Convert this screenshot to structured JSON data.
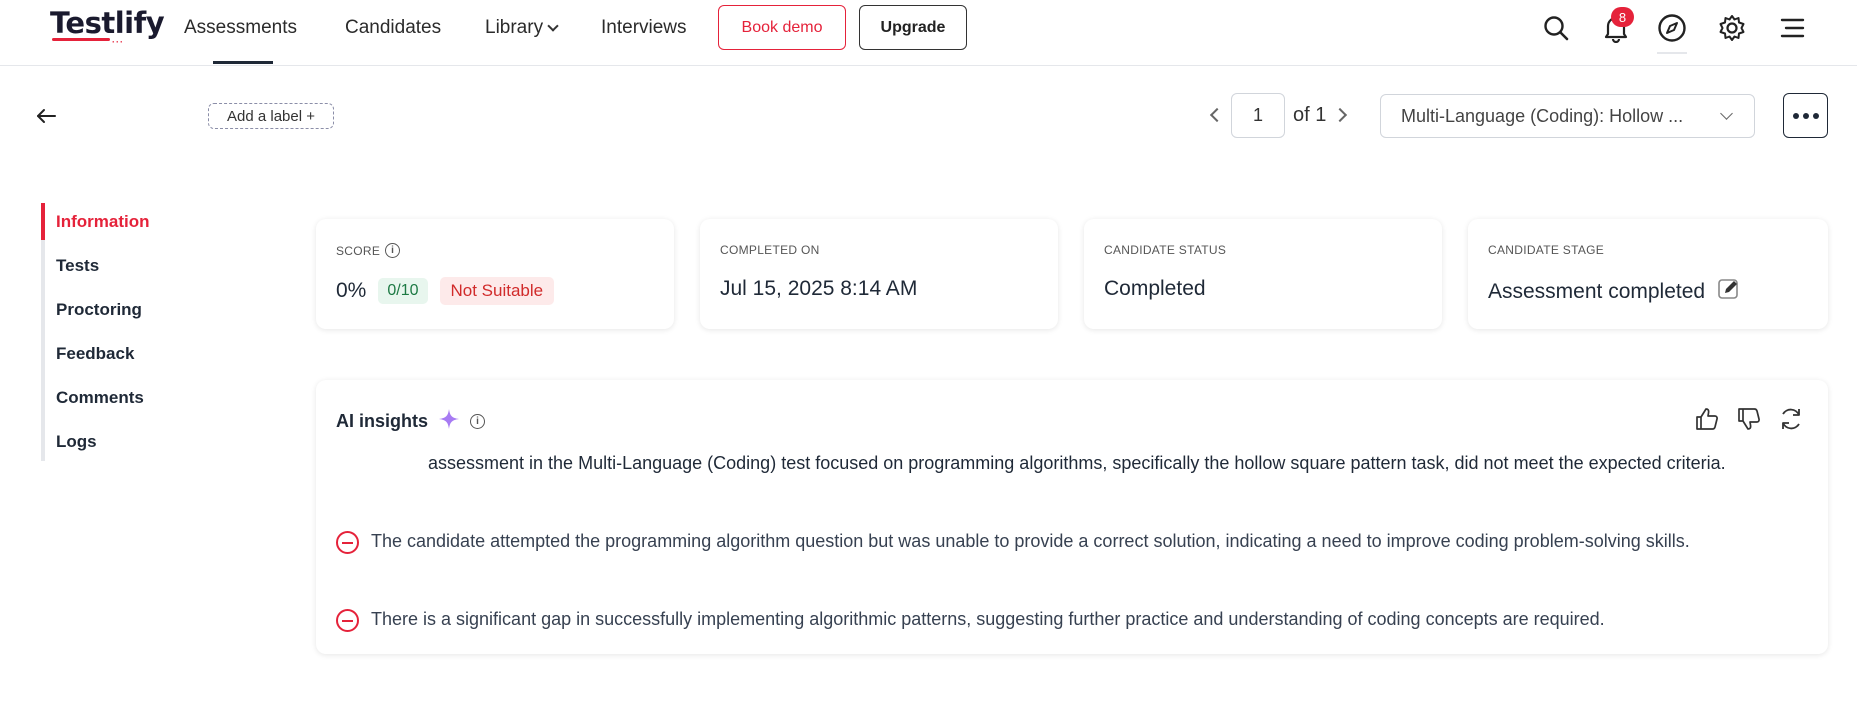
{
  "brand": {
    "name": "Testlify",
    "accent": "#e5223a"
  },
  "nav": {
    "items": [
      {
        "label": "Assessments",
        "active": true
      },
      {
        "label": "Candidates"
      },
      {
        "label": "Library",
        "has_dropdown": true
      },
      {
        "label": "Interviews"
      }
    ],
    "book_demo_label": "Book demo",
    "upgrade_label": "Upgrade",
    "notification_count": "8",
    "icons": [
      "search-icon",
      "bell-icon",
      "compass-icon",
      "gear-icon",
      "menu-icon"
    ]
  },
  "header": {
    "add_label": "Add a label +",
    "pager": {
      "current": "1",
      "of_text": "of 1"
    },
    "test_select_value": "Multi-Language (Coding): Hollow ..."
  },
  "sidebar": {
    "items": [
      {
        "label": "Information",
        "active": true
      },
      {
        "label": "Tests"
      },
      {
        "label": "Proctoring"
      },
      {
        "label": "Feedback"
      },
      {
        "label": "Comments"
      },
      {
        "label": "Logs"
      }
    ]
  },
  "cards": {
    "score": {
      "label": "SCORE",
      "percent": "0%",
      "points": "0/10",
      "verdict": "Not Suitable"
    },
    "completed_on": {
      "label": "COMPLETED ON",
      "value": "Jul 15, 2025 8:14 AM"
    },
    "candidate_status": {
      "label": "CANDIDATE STATUS",
      "value": "Completed"
    },
    "candidate_stage": {
      "label": "CANDIDATE STAGE",
      "value": "Assessment completed"
    }
  },
  "insights": {
    "title": "AI insights",
    "summary": "assessment in the Multi-Language (Coding) test focused on programming algorithms, specifically the hollow square pattern task, did not meet the expected criteria.",
    "points": [
      "The candidate attempted the programming algorithm question but was unable to provide a correct solution, indicating a need to improve coding problem-solving skills.",
      "There is a significant gap in successfully implementing algorithmic patterns, suggesting further practice and understanding of coding concepts are required."
    ]
  }
}
